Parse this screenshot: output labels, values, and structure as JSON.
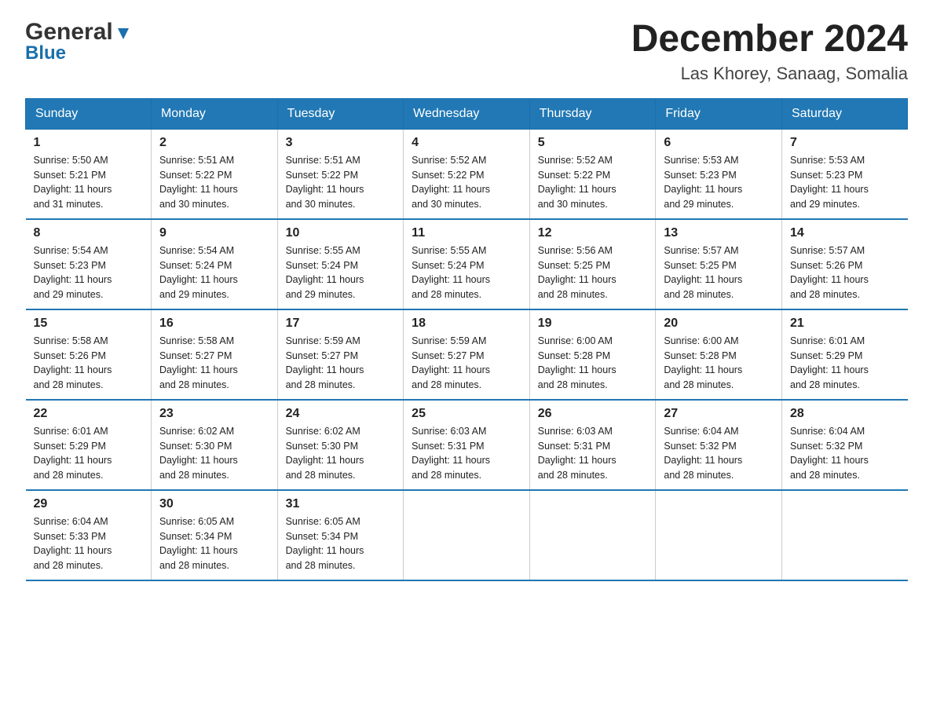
{
  "header": {
    "logo_general": "General",
    "logo_blue": "Blue",
    "title": "December 2024",
    "subtitle": "Las Khorey, Sanaag, Somalia"
  },
  "columns": [
    "Sunday",
    "Monday",
    "Tuesday",
    "Wednesday",
    "Thursday",
    "Friday",
    "Saturday"
  ],
  "weeks": [
    [
      {
        "day": "1",
        "sunrise": "5:50 AM",
        "sunset": "5:21 PM",
        "daylight": "11 hours and 31 minutes."
      },
      {
        "day": "2",
        "sunrise": "5:51 AM",
        "sunset": "5:22 PM",
        "daylight": "11 hours and 30 minutes."
      },
      {
        "day": "3",
        "sunrise": "5:51 AM",
        "sunset": "5:22 PM",
        "daylight": "11 hours and 30 minutes."
      },
      {
        "day": "4",
        "sunrise": "5:52 AM",
        "sunset": "5:22 PM",
        "daylight": "11 hours and 30 minutes."
      },
      {
        "day": "5",
        "sunrise": "5:52 AM",
        "sunset": "5:22 PM",
        "daylight": "11 hours and 30 minutes."
      },
      {
        "day": "6",
        "sunrise": "5:53 AM",
        "sunset": "5:23 PM",
        "daylight": "11 hours and 29 minutes."
      },
      {
        "day": "7",
        "sunrise": "5:53 AM",
        "sunset": "5:23 PM",
        "daylight": "11 hours and 29 minutes."
      }
    ],
    [
      {
        "day": "8",
        "sunrise": "5:54 AM",
        "sunset": "5:23 PM",
        "daylight": "11 hours and 29 minutes."
      },
      {
        "day": "9",
        "sunrise": "5:54 AM",
        "sunset": "5:24 PM",
        "daylight": "11 hours and 29 minutes."
      },
      {
        "day": "10",
        "sunrise": "5:55 AM",
        "sunset": "5:24 PM",
        "daylight": "11 hours and 29 minutes."
      },
      {
        "day": "11",
        "sunrise": "5:55 AM",
        "sunset": "5:24 PM",
        "daylight": "11 hours and 28 minutes."
      },
      {
        "day": "12",
        "sunrise": "5:56 AM",
        "sunset": "5:25 PM",
        "daylight": "11 hours and 28 minutes."
      },
      {
        "day": "13",
        "sunrise": "5:57 AM",
        "sunset": "5:25 PM",
        "daylight": "11 hours and 28 minutes."
      },
      {
        "day": "14",
        "sunrise": "5:57 AM",
        "sunset": "5:26 PM",
        "daylight": "11 hours and 28 minutes."
      }
    ],
    [
      {
        "day": "15",
        "sunrise": "5:58 AM",
        "sunset": "5:26 PM",
        "daylight": "11 hours and 28 minutes."
      },
      {
        "day": "16",
        "sunrise": "5:58 AM",
        "sunset": "5:27 PM",
        "daylight": "11 hours and 28 minutes."
      },
      {
        "day": "17",
        "sunrise": "5:59 AM",
        "sunset": "5:27 PM",
        "daylight": "11 hours and 28 minutes."
      },
      {
        "day": "18",
        "sunrise": "5:59 AM",
        "sunset": "5:27 PM",
        "daylight": "11 hours and 28 minutes."
      },
      {
        "day": "19",
        "sunrise": "6:00 AM",
        "sunset": "5:28 PM",
        "daylight": "11 hours and 28 minutes."
      },
      {
        "day": "20",
        "sunrise": "6:00 AM",
        "sunset": "5:28 PM",
        "daylight": "11 hours and 28 minutes."
      },
      {
        "day": "21",
        "sunrise": "6:01 AM",
        "sunset": "5:29 PM",
        "daylight": "11 hours and 28 minutes."
      }
    ],
    [
      {
        "day": "22",
        "sunrise": "6:01 AM",
        "sunset": "5:29 PM",
        "daylight": "11 hours and 28 minutes."
      },
      {
        "day": "23",
        "sunrise": "6:02 AM",
        "sunset": "5:30 PM",
        "daylight": "11 hours and 28 minutes."
      },
      {
        "day": "24",
        "sunrise": "6:02 AM",
        "sunset": "5:30 PM",
        "daylight": "11 hours and 28 minutes."
      },
      {
        "day": "25",
        "sunrise": "6:03 AM",
        "sunset": "5:31 PM",
        "daylight": "11 hours and 28 minutes."
      },
      {
        "day": "26",
        "sunrise": "6:03 AM",
        "sunset": "5:31 PM",
        "daylight": "11 hours and 28 minutes."
      },
      {
        "day": "27",
        "sunrise": "6:04 AM",
        "sunset": "5:32 PM",
        "daylight": "11 hours and 28 minutes."
      },
      {
        "day": "28",
        "sunrise": "6:04 AM",
        "sunset": "5:32 PM",
        "daylight": "11 hours and 28 minutes."
      }
    ],
    [
      {
        "day": "29",
        "sunrise": "6:04 AM",
        "sunset": "5:33 PM",
        "daylight": "11 hours and 28 minutes."
      },
      {
        "day": "30",
        "sunrise": "6:05 AM",
        "sunset": "5:34 PM",
        "daylight": "11 hours and 28 minutes."
      },
      {
        "day": "31",
        "sunrise": "6:05 AM",
        "sunset": "5:34 PM",
        "daylight": "11 hours and 28 minutes."
      },
      null,
      null,
      null,
      null
    ]
  ],
  "labels": {
    "sunrise": "Sunrise:",
    "sunset": "Sunset:",
    "daylight": "Daylight:"
  }
}
